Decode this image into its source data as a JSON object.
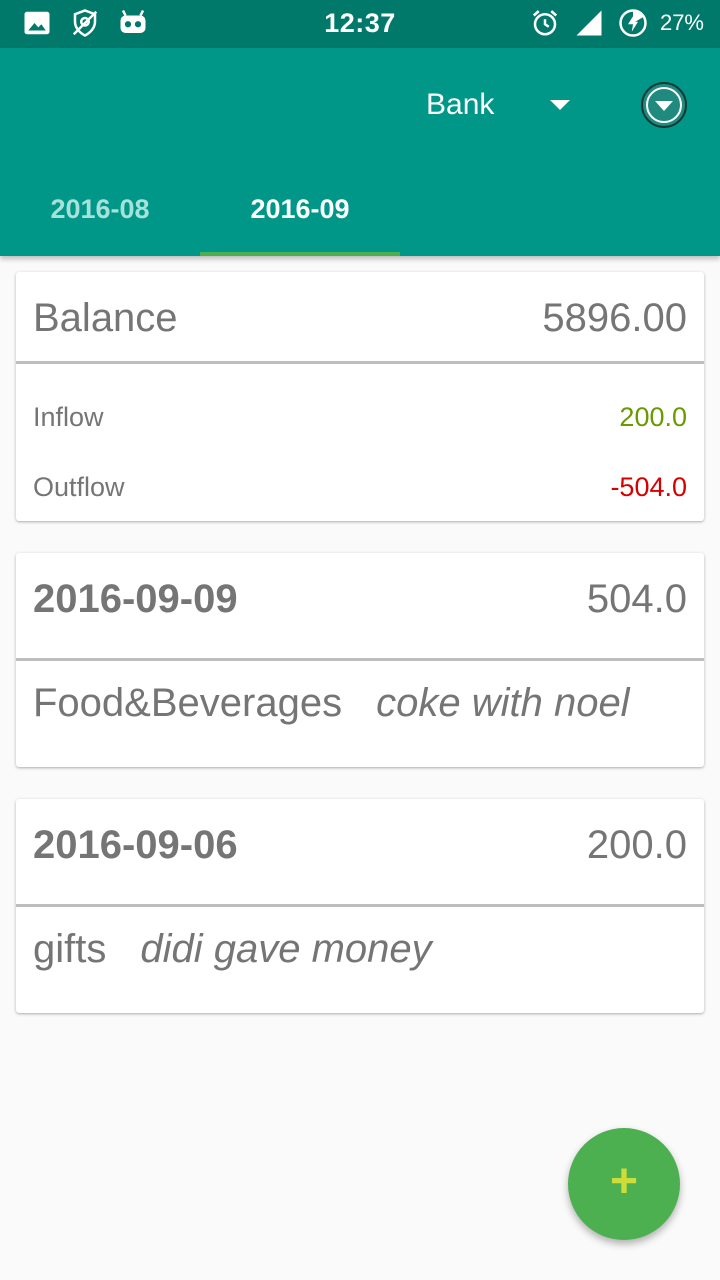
{
  "status_bar": {
    "time": "12:37",
    "battery": "27%",
    "left_icons": [
      "image-icon",
      "location-off-icon",
      "android-icon"
    ],
    "right_icons": [
      "alarm-icon",
      "signal-icon",
      "battery-charging-icon"
    ]
  },
  "header": {
    "account": "Bank",
    "filter_icon": "chevron-down-circle-icon",
    "tabs": [
      {
        "label": "2016-08",
        "active": false
      },
      {
        "label": "2016-09",
        "active": true
      }
    ]
  },
  "summary": {
    "balance_label": "Balance",
    "balance_value": "5896.00",
    "inflow_label": "Inflow",
    "inflow_value": "200.0",
    "outflow_label": "Outflow",
    "outflow_value": "-504.0"
  },
  "days": [
    {
      "date": "2016-09-09",
      "total": "504.0",
      "transactions": [
        {
          "category": "Food&Beverages",
          "note": "coke with noel"
        }
      ]
    },
    {
      "date": "2016-09-06",
      "total": "200.0",
      "transactions": [
        {
          "category": "gifts",
          "note": "didi gave money"
        }
      ]
    }
  ],
  "fab": {
    "label": "+",
    "icon": "add-icon"
  },
  "colors": {
    "status_bar": "#00796b",
    "app_bar": "#009688",
    "tab_indicator": "#4caf50",
    "inflow": "#6a9a00",
    "outflow": "#d50000",
    "fab": "#4caf50"
  }
}
